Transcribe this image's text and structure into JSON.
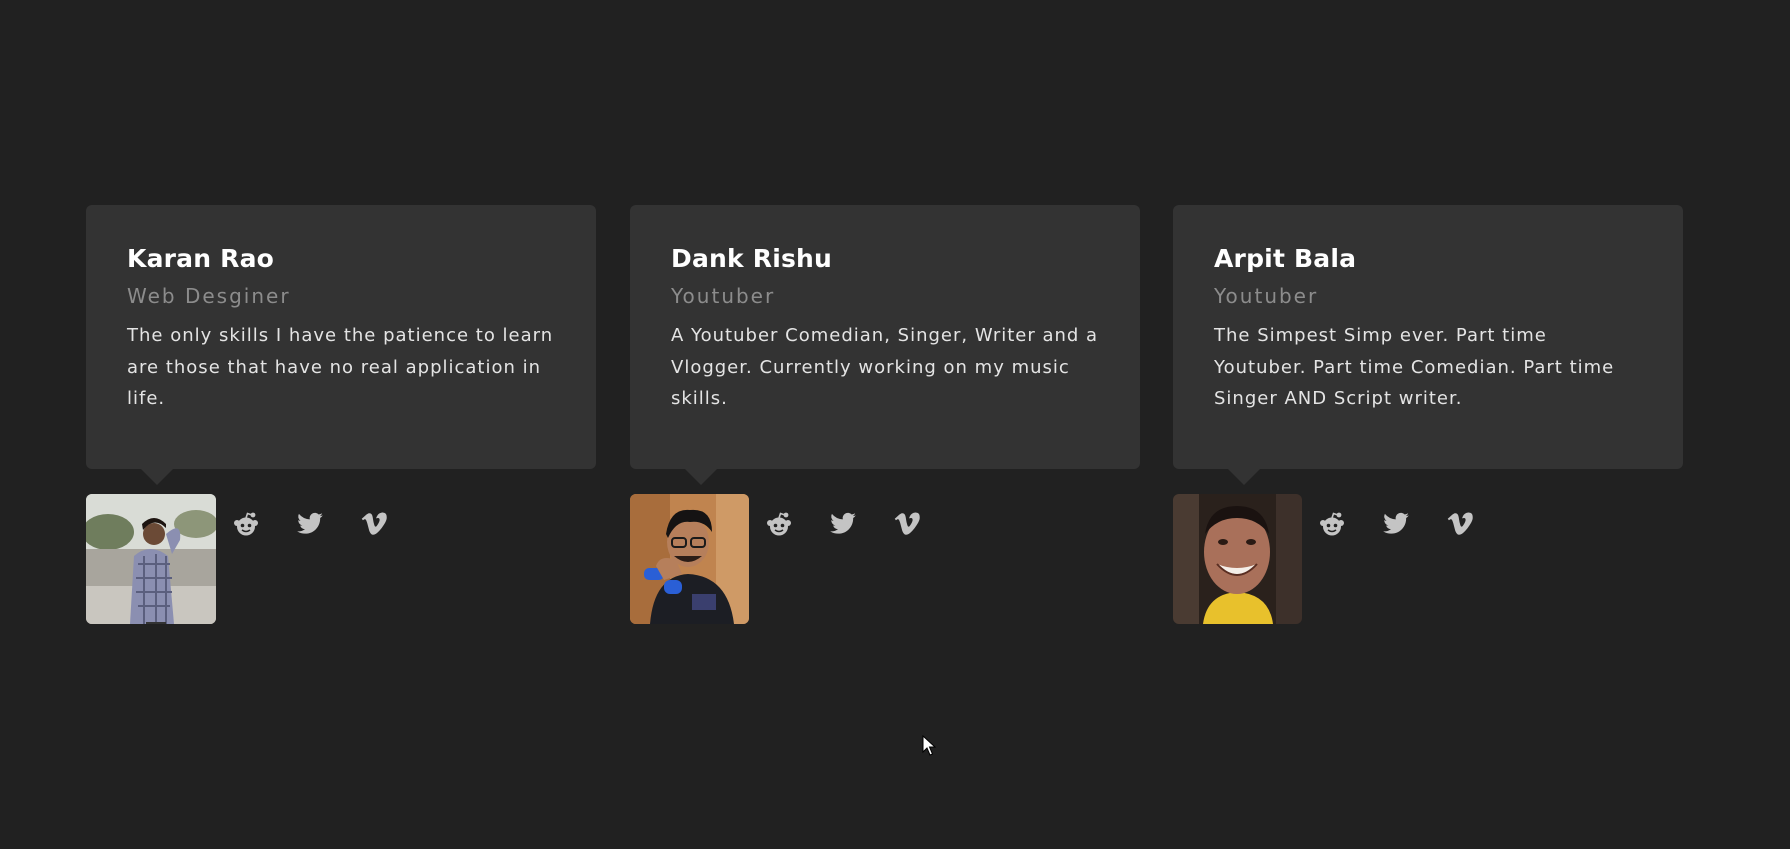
{
  "cards": [
    {
      "name": "Karan Rao",
      "role": "Web Desginer",
      "bio": "The only skills I have the patience to learn are those that have no real application in life.",
      "socials": [
        "reddit-icon",
        "twitter-icon",
        "vimeo-icon"
      ]
    },
    {
      "name": "Dank Rishu",
      "role": "Youtuber",
      "bio": "A Youtuber Comedian, Singer, Writer and a Vlogger. Currently working on my music skills.",
      "socials": [
        "reddit-icon",
        "twitter-icon",
        "vimeo-icon"
      ]
    },
    {
      "name": "Arpit Bala",
      "role": "Youtuber",
      "bio": "The Simpest Simp ever. Part time Youtuber. Part time Comedian. Part time Singer AND Script writer.",
      "socials": [
        "reddit-icon",
        "twitter-icon",
        "vimeo-icon"
      ]
    }
  ],
  "colors": {
    "background": "#212121",
    "card": "#333333",
    "name": "#ffffff",
    "role": "#8c8c8c",
    "bio": "#e4e4e4",
    "icon": "#c4c4c4"
  }
}
